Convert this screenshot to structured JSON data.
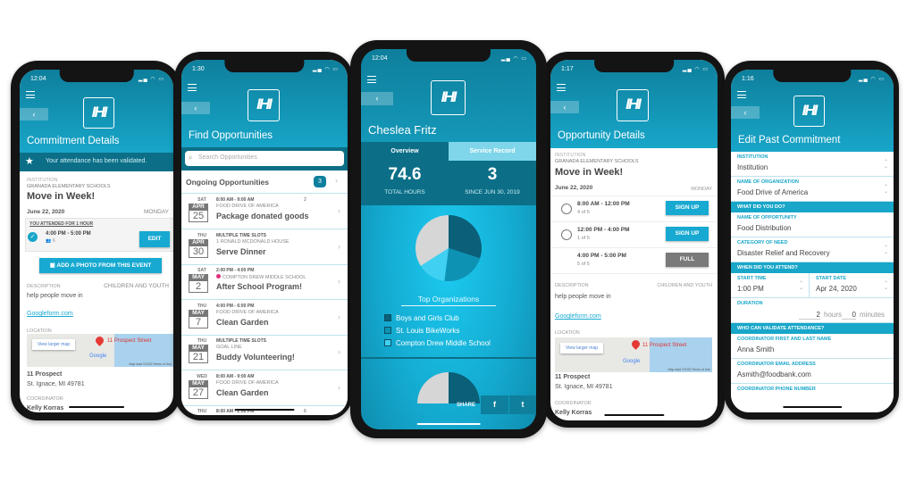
{
  "colors": {
    "brand": "#18a6c9",
    "brand_dark": "#0c6f87",
    "full": "#7a7a7a"
  },
  "logo_text": "IHI",
  "commitment": {
    "status_time": "12:04",
    "title": "Commitment Details",
    "banner": "Your attendance has been validated.",
    "institution_label": "INSTITUTION",
    "institution": "GRANADA ELEMENTARY SCHOOLS",
    "event": "Move in Week!",
    "date": "June 22, 2020",
    "weekday": "MONDAY",
    "attended": "YOU ATTENDED FOR 1 HOUR",
    "slot_time": "4:00 PM - 5:00 PM",
    "slot_count": "6",
    "edit": "EDIT",
    "photo_button": "ADD A PHOTO FROM THIS EVENT",
    "description_label": "DESCRIPTION",
    "category": "CHILDREN AND YOUTH",
    "description": "help people move in",
    "link": "Googleform.com",
    "location_label": "LOCATION",
    "map": {
      "view_larger": "View larger map",
      "street": "11 Prospect Street",
      "google": "Google",
      "map_data": "Map data ©2020   Terms of Use"
    },
    "address1": "11 Prospect",
    "address2": "St. Ignace, MI 49781",
    "coordinator_label": "COORDINATOR",
    "coordinator": "Kelly Korras"
  },
  "find": {
    "status_time": "1:30",
    "title": "Find Opportunities",
    "search_placeholder": "Search Opportunities",
    "ongoing": "Ongoing Opportunities",
    "ongoing_count": "3",
    "items": [
      {
        "dow": "SAT",
        "mon": "APR",
        "day": "25",
        "time": "8:00 AM - 9:00 AM",
        "org": "FOOD DRIVE OF AMERICA",
        "name": "Package donated goods",
        "people": "2"
      },
      {
        "dow": "THU",
        "mon": "APR",
        "day": "30",
        "time": "MULTIPLE TIME SLOTS",
        "org": "1 RONALD MCDONALD HOUSE",
        "name": "Serve Dinner"
      },
      {
        "dow": "SAT",
        "mon": "MAY",
        "day": "2",
        "time": "2:00 PM - 4:00 PM",
        "org": "COMPTON DREW MIDDLE SCHOOL",
        "name": "After School Program!",
        "dot": "#e0307a"
      },
      {
        "dow": "THU",
        "mon": "MAY",
        "day": "7",
        "time": "4:00 PM - 6:00 PM",
        "org": "FOOD DRIVE OF AMERICA",
        "name": "Clean Garden"
      },
      {
        "dow": "THU",
        "mon": "MAY",
        "day": "21",
        "time": "MULTIPLE TIME SLOTS",
        "org": "GOAL LINE",
        "name": "Buddy Volunteering!"
      },
      {
        "dow": "WED",
        "mon": "MAY",
        "day": "27",
        "time": "8:00 AM - 9:00 AM",
        "org": "FOOD DRIVE OF AMERICA",
        "name": "Clean Garden"
      },
      {
        "dow": "THU",
        "mon": "",
        "day": "",
        "time": "8:00 AM - 2:00 PM",
        "org": "",
        "name": "",
        "people": "6"
      }
    ]
  },
  "profile": {
    "status_time": "12:04",
    "name": "Cheslea Fritz",
    "tabs": [
      "Overview",
      "Service Record"
    ],
    "total_hours": "74.6",
    "total_hours_label": "TOTAL HOURS",
    "count": "3",
    "count_label": "SINCE JUN 30, 2019",
    "top_orgs_title": "Top Organizations",
    "pie": [
      {
        "name": "Boys and Girls Club",
        "share": 30,
        "color": "#0b5f78"
      },
      {
        "name": "St. Louis BikeWorks",
        "share": 22,
        "color": "#0e92b4"
      },
      {
        "name": "Compton Drew Middle School",
        "share": 14,
        "color": "#3fd0f2"
      },
      {
        "share": 34,
        "color": "#d6d6d6"
      }
    ],
    "share": "SHARE",
    "facebook": "f",
    "twitter": "t"
  },
  "opportunity": {
    "status_time": "1:17",
    "title": "Opportunity Details",
    "institution_label": "INSTITUTION",
    "institution": "GRANADA ELEMENTARY SCHOOLS",
    "event": "Move in Week!",
    "date": "June 22, 2020",
    "weekday": "MONDAY",
    "slots": [
      {
        "time": "8:00 AM - 12:00 PM",
        "count": "4 of 5",
        "action": "SIGN UP"
      },
      {
        "time": "12:00 PM - 4:00 PM",
        "count": "1 of 5",
        "action": "SIGN UP"
      },
      {
        "time": "4:00 PM - 5:00 PM",
        "count": "5 of 5",
        "action": "FULL"
      }
    ],
    "description_label": "DESCRIPTION",
    "category": "CHILDREN AND YOUTH",
    "description": "help people move in",
    "link": "Googleform.com",
    "location_label": "LOCATION",
    "map": {
      "view_larger": "View larger map",
      "street": "11 Prospect Street",
      "google": "Google",
      "map_data": "Map data ©2020   Terms of Use"
    },
    "address1": "11 Prospect",
    "address2": "St. Ignace, MI 49781",
    "coordinator_label": "COORDINATOR",
    "coordinator": "Kelly Korras"
  },
  "edit": {
    "status_time": "1:16",
    "title": "Edit Past Commitment",
    "institution_label": "INSTITUTION",
    "institution": "Institution",
    "org_label": "NAME OF ORGANIZATION",
    "org": "Food Drive of America",
    "section1": "WHAT DID YOU DO?",
    "opp_label": "NAME OF OPPORTUNITY",
    "opp": "Food Distribution",
    "need_label": "CATEGORY OF NEED",
    "need": "Disaster Relief and Recovery",
    "section2": "WHEN DID YOU ATTEND?",
    "start_time_label": "START TIME",
    "start_time": "1:00 PM",
    "start_date_label": "START DATE",
    "start_date": "Apr 24, 2020",
    "duration_label": "DURATION",
    "hours": "2",
    "hours_unit": "hours",
    "minutes": "0",
    "minutes_unit": "minutes",
    "section3": "WHO CAN VALIDATE ATTENDANCE?",
    "coord_name_label": "COORDINATOR FIRST AND LAST NAME",
    "coord_name": "Anna Smith",
    "coord_email_label": "COORDINATOR EMAIL ADDRESS",
    "coord_email": "Asmith@foodbank.com",
    "coord_phone_label": "COORDINATOR PHONE NUMBER"
  }
}
